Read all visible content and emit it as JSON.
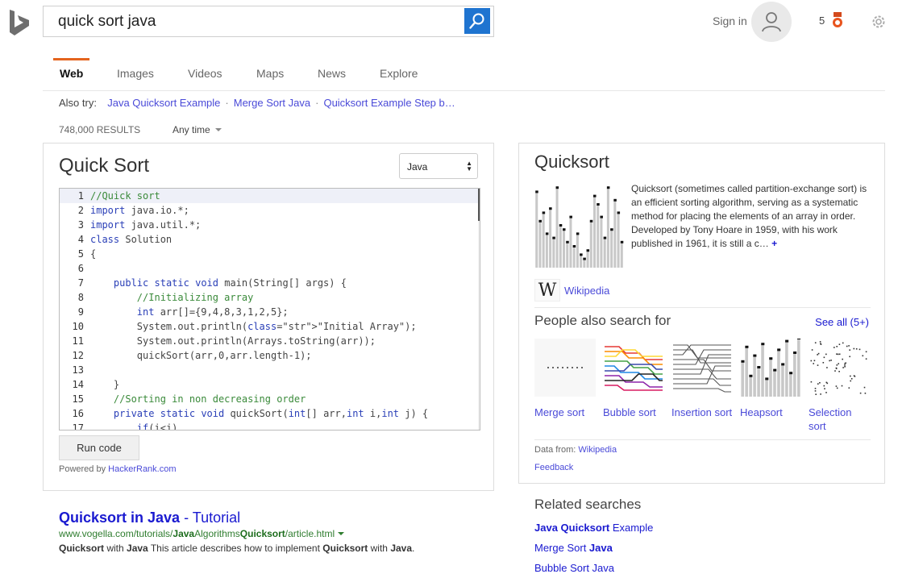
{
  "search": {
    "query": "quick sort java"
  },
  "header": {
    "signin_label": "Sign in",
    "rewards_count": "5"
  },
  "tabs": [
    {
      "label": "Web",
      "active": true
    },
    {
      "label": "Images"
    },
    {
      "label": "Videos"
    },
    {
      "label": "Maps"
    },
    {
      "label": "News"
    },
    {
      "label": "Explore"
    }
  ],
  "also_try": {
    "label": "Also try:",
    "links": [
      "Java Quicksort Example",
      "Merge Sort Java",
      "Quicksort Example Step b…"
    ]
  },
  "results_meta": {
    "count": "748,000 RESULTS",
    "time_filter": "Any time"
  },
  "code_card": {
    "title": "Quick Sort",
    "language": "Java",
    "run_label": "Run code",
    "powered_prefix": "Powered by ",
    "powered_link": "HackerRank.com",
    "lines": [
      "//Quick sort",
      "import java.io.*;",
      "import java.util.*;",
      "class Solution",
      "{",
      "",
      "    public static void main(String[] args) {",
      "        //Initializing array",
      "        int arr[]={9,4,8,3,1,2,5};",
      "        System.out.println(\"Initial Array\");",
      "        System.out.println(Arrays.toString(arr));",
      "        quickSort(arr,0,arr.length-1);",
      "",
      "    }",
      "    //Sorting in non decreasing order",
      "    private static void quickSort(int[] arr,int i,int j) {",
      "        if(i<j)"
    ]
  },
  "result1": {
    "title_b1": "Quicksort in Java",
    "title_sep": " - Tutorial",
    "url_pre": "www.vogella.com/tutorials/",
    "url_b1": "Java",
    "url_mid1": "Algorithms",
    "url_b2": "Quicksort",
    "url_post": "/article.html",
    "snippet_b1": "Quicksort",
    "snippet_t1": " with ",
    "snippet_b2": "Java",
    "snippet_t2": " This article describes how to implement ",
    "snippet_b3": "Quicksort",
    "snippet_t3": " with ",
    "snippet_b4": "Java",
    "snippet_t4": "."
  },
  "knowledge_panel": {
    "title": "Quicksort",
    "description": "Quicksort (sometimes called partition-exchange sort) is an efficient sorting algorithm, serving as a systematic method for placing the elements of an array in order. Developed by Tony Hoare in 1959, with his work published in 1961, it is still a c…",
    "more": "+",
    "wiki_logo": "W",
    "wiki_label": "Wikipedia",
    "pas_title": "People also search for",
    "see_all": "See all (5+)",
    "pas": [
      "Merge sort",
      "Bubble sort",
      "Insertion sort",
      "Heapsort",
      "Selection sort"
    ],
    "source_prefix": "Data from: ",
    "source_link": "Wikipedia",
    "feedback": "Feedback"
  },
  "related": {
    "title": "Related searches",
    "items": [
      {
        "b": "Java Quicksort",
        "t": " Example"
      },
      {
        "t": "Merge Sort ",
        "b": "Java"
      },
      {
        "t": "Bubble Sort Java",
        "b": ""
      }
    ]
  }
}
